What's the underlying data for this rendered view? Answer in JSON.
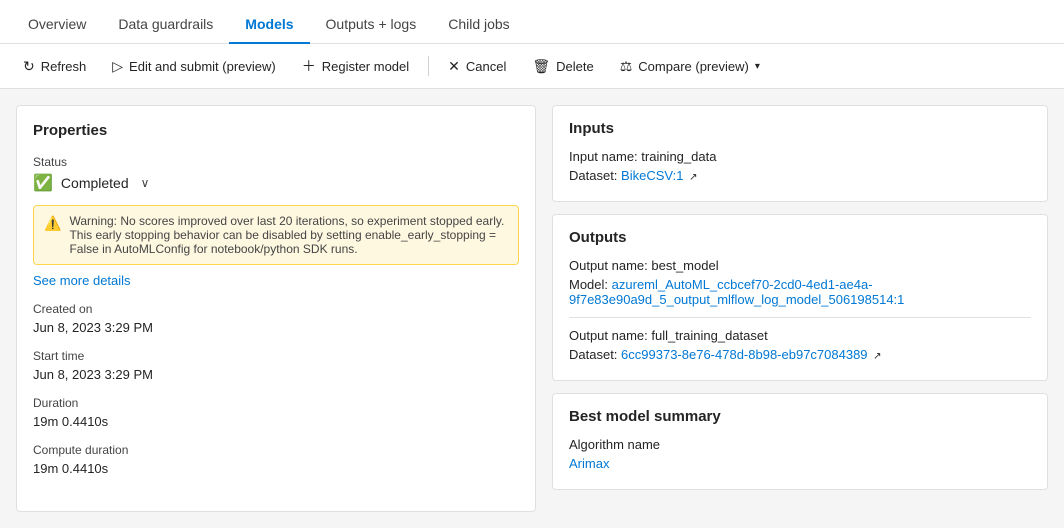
{
  "tabs": [
    {
      "id": "overview",
      "label": "Overview",
      "active": false
    },
    {
      "id": "data-guardrails",
      "label": "Data guardrails",
      "active": false
    },
    {
      "id": "models",
      "label": "Models",
      "active": true
    },
    {
      "id": "outputs-logs",
      "label": "Outputs + logs",
      "active": false
    },
    {
      "id": "child-jobs",
      "label": "Child jobs",
      "active": false
    }
  ],
  "toolbar": {
    "refresh_label": "Refresh",
    "edit_submit_label": "Edit and submit (preview)",
    "register_model_label": "Register model",
    "cancel_label": "Cancel",
    "delete_label": "Delete",
    "compare_label": "Compare (preview)"
  },
  "left_panel": {
    "title": "Properties",
    "status_label": "Status",
    "status_value": "Completed",
    "warning_text": "Warning: No scores improved over last 20 iterations, so experiment stopped early. This early stopping behavior can be disabled by setting enable_early_stopping = False in AutoMLConfig for notebook/python SDK runs.",
    "see_more_label": "See more details",
    "created_on_label": "Created on",
    "created_on_value": "Jun 8, 2023 3:29 PM",
    "start_time_label": "Start time",
    "start_time_value": "Jun 8, 2023 3:29 PM",
    "duration_label": "Duration",
    "duration_value": "19m 0.4410s",
    "compute_duration_label": "Compute duration",
    "compute_duration_value": "19m 0.4410s"
  },
  "inputs_card": {
    "title": "Inputs",
    "input_name_label": "Input name: training_data",
    "dataset_label": "Dataset:",
    "dataset_link": "BikeCSV:1"
  },
  "outputs_card": {
    "title": "Outputs",
    "output1_name": "Output name: best_model",
    "model_label": "Model:",
    "model_link": "azureml_AutoML_ccbcef70-2cd0-4ed1-ae4a-9f7e83e90a9d_5_output_mlflow_log_model_506198514:1",
    "output2_name": "Output name: full_training_dataset",
    "dataset_label": "Dataset:",
    "dataset2_link": "6cc99373-8e76-478d-8b98-eb97c7084389"
  },
  "best_model_card": {
    "title": "Best model summary",
    "algorithm_label": "Algorithm name",
    "algorithm_link": "Arimax"
  }
}
